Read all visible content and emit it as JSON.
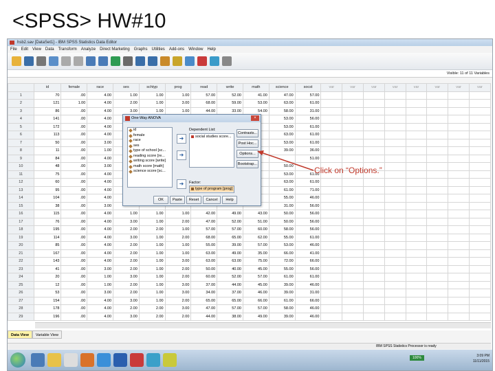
{
  "slide": {
    "title": "<SPSS> HW#10",
    "callout": "Click on “Options.”"
  },
  "window": {
    "title": "hsb2.sav [DataSet1] - IBM SPSS Statistics Data Editor"
  },
  "menu": [
    "File",
    "Edit",
    "View",
    "Data",
    "Transform",
    "Analyze",
    "Direct Marketing",
    "Graphs",
    "Utilities",
    "Add-ons",
    "Window",
    "Help"
  ],
  "infobar": {
    "visible": "Visible: 11 of 11 Variables"
  },
  "columns": [
    "id",
    "female",
    "race",
    "ses",
    "schtyp",
    "prog",
    "read",
    "write",
    "math",
    "science",
    "socst",
    "var",
    "var",
    "var",
    "var",
    "var",
    "var",
    "var",
    "var"
  ],
  "rows": [
    [
      "70",
      ".00",
      "4.00",
      "1.00",
      "1.00",
      "1.00",
      "57.00",
      "52.00",
      "41.00",
      "47.00",
      "57.00"
    ],
    [
      "121",
      "1.00",
      "4.00",
      "2.00",
      "1.00",
      "3.00",
      "68.00",
      "59.00",
      "53.00",
      "63.00",
      "61.00"
    ],
    [
      "86",
      ".00",
      "4.00",
      "3.00",
      "1.00",
      "1.00",
      "44.00",
      "33.00",
      "54.00",
      "58.00",
      "31.00"
    ],
    [
      "141",
      ".00",
      "4.00",
      "",
      "",
      "",
      "",
      "",
      "",
      "53.00",
      "56.00"
    ],
    [
      "172",
      ".00",
      "4.00",
      "",
      "",
      "",
      "",
      "",
      "",
      "53.00",
      "61.00"
    ],
    [
      "113",
      ".00",
      "4.00",
      "",
      "",
      "",
      "",
      "",
      "",
      "63.00",
      "61.00"
    ],
    [
      "50",
      ".00",
      "3.00",
      "",
      "",
      "",
      "",
      "",
      "",
      "53.00",
      "61.00"
    ],
    [
      "11",
      ".00",
      "1.00",
      "",
      "",
      "",
      "",
      "",
      "",
      "39.00",
      "36.00"
    ],
    [
      "84",
      ".00",
      "4.00",
      "",
      "",
      "",
      "",
      "",
      "",
      "",
      "51.00"
    ],
    [
      "48",
      ".00",
      "3.00",
      "",
      "",
      "",
      "",
      "",
      "",
      "50.00",
      ""
    ],
    [
      "75",
      ".00",
      "4.00",
      "",
      "",
      "",
      "",
      "",
      "",
      "53.00",
      "61.00"
    ],
    [
      "60",
      ".00",
      "4.00",
      "",
      "",
      "",
      "",
      "",
      "",
      "63.00",
      "61.00"
    ],
    [
      "95",
      ".00",
      "4.00",
      "",
      "",
      "",
      "",
      "",
      "",
      "61.00",
      "71.00"
    ],
    [
      "104",
      ".00",
      "4.00",
      "",
      "",
      "",
      "",
      "",
      "",
      "55.00",
      "46.00"
    ],
    [
      "38",
      ".00",
      "3.00",
      "",
      "",
      "",
      "",
      "",
      "",
      "31.00",
      "56.00"
    ],
    [
      "115",
      ".00",
      "4.00",
      "1.00",
      "1.00",
      "1.00",
      "42.00",
      "49.00",
      "43.00",
      "50.00",
      "56.00"
    ],
    [
      "76",
      ".00",
      "4.00",
      "3.00",
      "1.00",
      "2.00",
      "47.00",
      "52.00",
      "51.00",
      "50.00",
      "56.00"
    ],
    [
      "195",
      ".00",
      "4.00",
      "2.00",
      "2.00",
      "1.00",
      "57.00",
      "57.00",
      "60.00",
      "58.00",
      "56.00"
    ],
    [
      "114",
      ".00",
      "4.00",
      "3.00",
      "1.00",
      "2.00",
      "68.00",
      "65.00",
      "62.00",
      "55.00",
      "61.00"
    ],
    [
      "85",
      ".00",
      "4.00",
      "2.00",
      "1.00",
      "1.00",
      "55.00",
      "39.00",
      "57.00",
      "53.00",
      "46.00"
    ],
    [
      "167",
      ".00",
      "4.00",
      "2.00",
      "1.00",
      "1.00",
      "63.00",
      "49.00",
      "35.00",
      "66.00",
      "41.00"
    ],
    [
      "143",
      ".00",
      "4.00",
      "2.00",
      "1.00",
      "3.00",
      "63.00",
      "63.00",
      "75.00",
      "72.00",
      "66.00"
    ],
    [
      "41",
      ".00",
      "3.00",
      "2.00",
      "1.00",
      "2.00",
      "50.00",
      "40.00",
      "45.00",
      "55.00",
      "56.00"
    ],
    [
      "20",
      ".00",
      "1.00",
      "3.00",
      "1.00",
      "2.00",
      "60.00",
      "52.00",
      "57.00",
      "61.00",
      "61.00"
    ],
    [
      "12",
      ".00",
      "1.00",
      "2.00",
      "1.00",
      "3.00",
      "37.00",
      "44.00",
      "45.00",
      "39.00",
      "46.00"
    ],
    [
      "53",
      ".00",
      "3.00",
      "2.00",
      "1.00",
      "3.00",
      "34.00",
      "37.00",
      "46.00",
      "39.00",
      "31.00"
    ],
    [
      "154",
      ".00",
      "4.00",
      "3.00",
      "1.00",
      "2.00",
      "65.00",
      "65.00",
      "66.00",
      "61.00",
      "66.00"
    ],
    [
      "178",
      ".00",
      "4.00",
      "2.00",
      "2.00",
      "3.00",
      "47.00",
      "57.00",
      "57.00",
      "58.00",
      "46.00"
    ],
    [
      "196",
      ".00",
      "4.00",
      "3.00",
      "2.00",
      "2.00",
      "44.00",
      "38.00",
      "49.00",
      "39.00",
      "46.00"
    ]
  ],
  "tabs": {
    "data_view": "Data View",
    "variable_view": "Variable View"
  },
  "status": "IBM SPSS Statistics Processor is ready",
  "taskbar": {
    "zoom": "100%",
    "time": "3:09 PM",
    "date": "11/11/2015"
  },
  "dialog": {
    "title": "One-Way ANOVA",
    "variables": [
      "id",
      "female",
      "race",
      "ses",
      "type of school [sc...",
      "reading score [re...",
      "writing score [write]",
      "math score [math]",
      "science score [sc..."
    ],
    "dependent_label": "Dependent List:",
    "dependent_item": "social studies score...",
    "factor_label": "Factor:",
    "factor_item": "type of program [prog]",
    "buttons": {
      "contrasts": "Contrasts...",
      "posthoc": "Post Hoc...",
      "options": "Options...",
      "bootstrap": "Bootstrap...",
      "ok": "OK",
      "paste": "Paste",
      "reset": "Reset",
      "cancel": "Cancel",
      "help": "Help"
    }
  },
  "colors": {
    "callout": "#c0392b",
    "tab_active": "#fff4a8",
    "taskbar": "#9db6cf"
  }
}
